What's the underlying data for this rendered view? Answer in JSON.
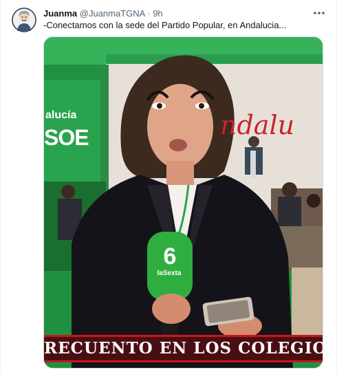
{
  "tweet": {
    "author_name": "Juanma",
    "handle": "@JuanmaTGNA",
    "separator": "·",
    "time": "9h",
    "text": "-Conectamos con la sede del Partido Popular, en Andalucia..."
  },
  "media": {
    "banner_left_line1": "alucía",
    "banner_left_line2": "SOE",
    "wall_text": "ndalu",
    "mic_brand": "laSexta",
    "ticker": "RECUENTO EN LOS COLEGIOS"
  },
  "icons": {
    "avatar": "avatar-cartoon",
    "more": "more-horizontal-icon"
  },
  "colors": {
    "name": "#0f1419",
    "secondary": "#536471",
    "ticker_bg": "#4a0e12",
    "ticker_border": "#c9161d",
    "studio_green": "#1d8f3e"
  }
}
